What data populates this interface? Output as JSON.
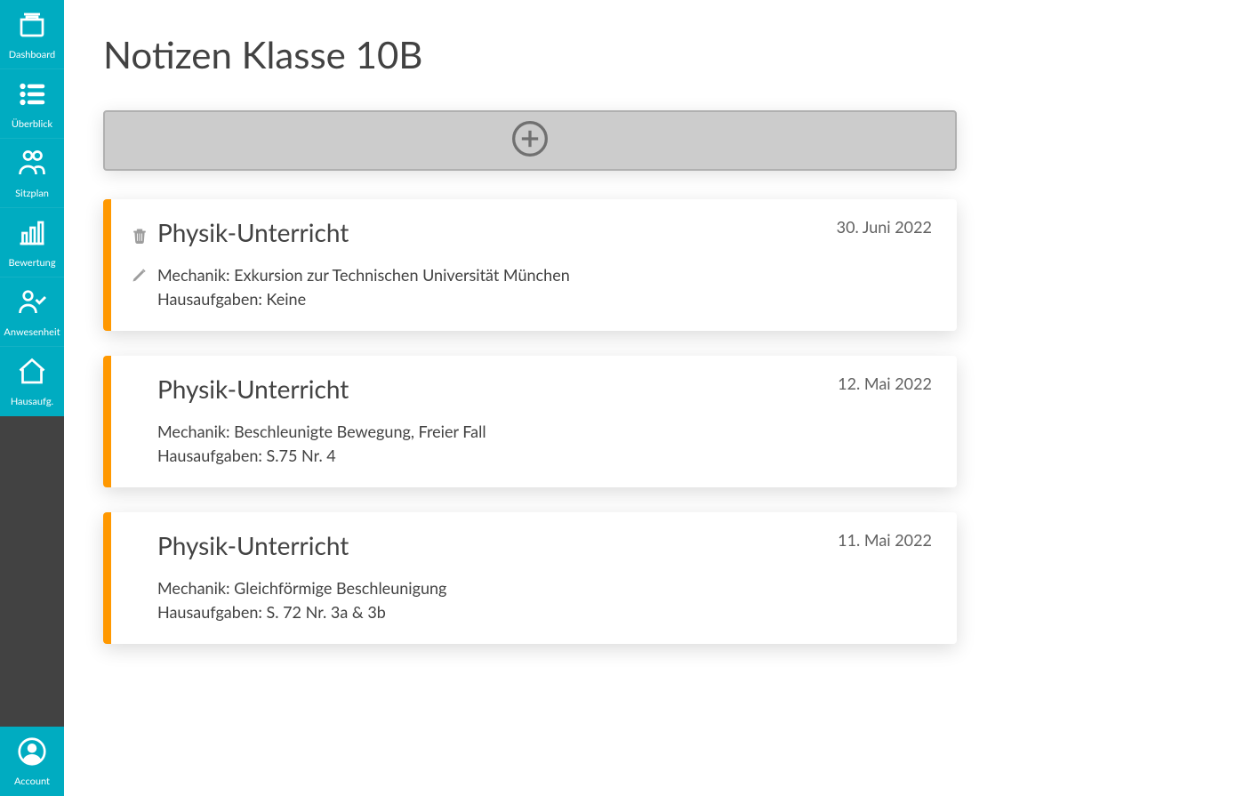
{
  "sidebar": {
    "items": [
      {
        "id": "dashboard",
        "label": "Dashboard"
      },
      {
        "id": "overview",
        "label": "Überblick"
      },
      {
        "id": "seating",
        "label": "Sitzplan"
      },
      {
        "id": "grading",
        "label": "Bewertung"
      },
      {
        "id": "attendance",
        "label": "Anwesenheit"
      },
      {
        "id": "homework",
        "label": "Hausaufg."
      }
    ],
    "account": {
      "label": "Account"
    }
  },
  "page": {
    "title": "Notizen Klasse 10B"
  },
  "notes": [
    {
      "title": "Physik-Unterricht",
      "date": "30. Juni 2022",
      "line1": "Mechanik: Exkursion zur Technischen Universität München",
      "line2": "Hausaufgaben: Keine",
      "showActions": true
    },
    {
      "title": "Physik-Unterricht",
      "date": "12. Mai 2022",
      "line1": "Mechanik: Beschleunigte Bewegung, Freier Fall",
      "line2": "Hausaufgaben: S.75 Nr. 4",
      "showActions": false
    },
    {
      "title": "Physik-Unterricht",
      "date": "11. Mai 2022",
      "line1": "Mechanik: Gleichförmige Beschleunigung",
      "line2": "Hausaufgaben: S. 72 Nr. 3a & 3b",
      "showActions": false
    }
  ]
}
